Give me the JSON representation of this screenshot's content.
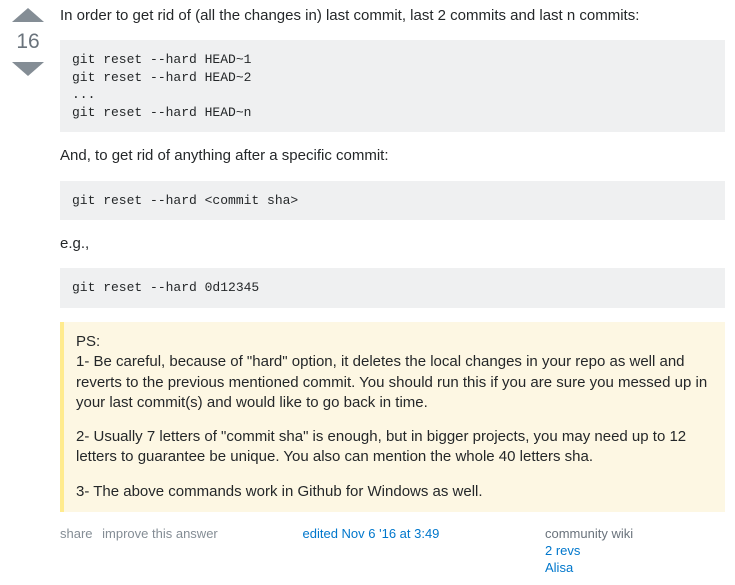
{
  "vote": {
    "count": "16"
  },
  "post": {
    "intro": "In order to get rid of (all the changes in) last commit, last 2 commits and last n commits:",
    "code1": "git reset --hard HEAD~1\ngit reset --hard HEAD~2\n...\ngit reset --hard HEAD~n",
    "mid": "And, to get rid of anything after a specific commit:",
    "code2": "git reset --hard <commit sha>",
    "eg": "e.g.,",
    "code3": "git reset --hard 0d12345",
    "ps": {
      "heading": "PS:",
      "p1": "1- Be careful, because of \"hard\" option, it deletes the local changes in your repo as well and reverts to the previous mentioned commit. You should run this if you are sure you messed up in your last commit(s) and would like to go back in time.",
      "p2": "2- Usually 7 letters of \"commit sha\" is enough, but in bigger projects, you may need up to 12 letters to guarantee be unique. You also can mention the whole 40 letters sha.",
      "p3": "3- The above commands work in Github for Windows as well."
    }
  },
  "menu": {
    "share": "share",
    "improve": "improve this answer",
    "edited": "edited Nov 6 '16 at 3:49",
    "community": "community wiki",
    "revs": "2 revs",
    "author": "Alisa"
  }
}
